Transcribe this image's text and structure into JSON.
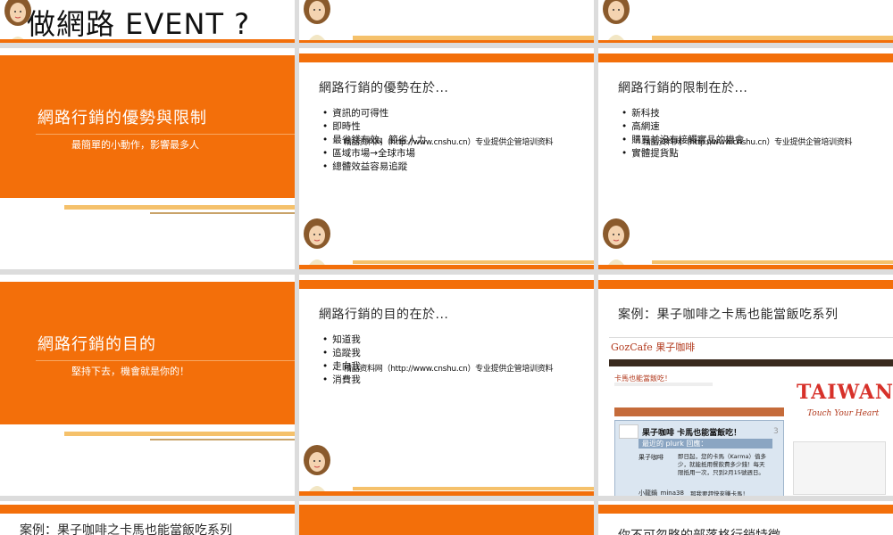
{
  "slides": {
    "top_row": {
      "event_heading": "做網路 EVENT ?"
    },
    "s1": {
      "title": "網路行銷的優勢與限制",
      "subtitle": "最簡單的小動作，影響最多人"
    },
    "s2": {
      "title": "網路行銷的優勢在於...",
      "bullets": [
        "資訊的可得性",
        "即時性",
        "最省錢有效、節省人力",
        "區域市場→全球市場",
        "總體效益容易追蹤"
      ],
      "watermark": "精品资料网（http://www.cnshu.cn）专业提供企管培训资料"
    },
    "s3": {
      "title": "網路行銷的限制在於...",
      "bullets": [
        "新科技",
        "高網速",
        "購買前沒有接觸實品的機會",
        "實體提貨點"
      ],
      "watermark": "精品资料网（http://www.cnshu.cn）专业提供企管培训资料"
    },
    "s4": {
      "title": "網路行銷的目的",
      "subtitle": "堅持下去，機會就是你的！"
    },
    "s5": {
      "title": "網路行銷的目的在於...",
      "bullets": [
        "知道我",
        "追蹤我",
        "走向我",
        "消費我"
      ],
      "watermark": "精品资料网（http://www.cnshu.cn）专业提供企管培训资料"
    },
    "s6": {
      "title": "案例：果子咖啡之卡馬也能當飯吃系列",
      "site": {
        "brand": "GozCafe 果子咖啡",
        "post_title": "卡馬也能當飯吃！",
        "plurk_heading": "果子咖啡 卡馬也能當飯吃！",
        "plurk_subheading": "最近的 plurk 回應：",
        "response1_user": "果子咖啡",
        "response1_text": "即日起，您的卡馬（Karma）值多少，就能抵用餐飲費多少錢！每天限抵用一次，只到2月15號週日。",
        "response2_user": "小龍鍋_mina38",
        "response2_text": "那我要趕快來賺卡馬！",
        "banner_word": "TAIWAN",
        "banner_tagline": "Touch Your Heart",
        "count": "3"
      }
    },
    "s7": {
      "title": "案例：果子咖啡之卡馬也能當飯吃系列"
    },
    "s9": {
      "title": "你不可忽略的部落格行銷特徵"
    }
  }
}
